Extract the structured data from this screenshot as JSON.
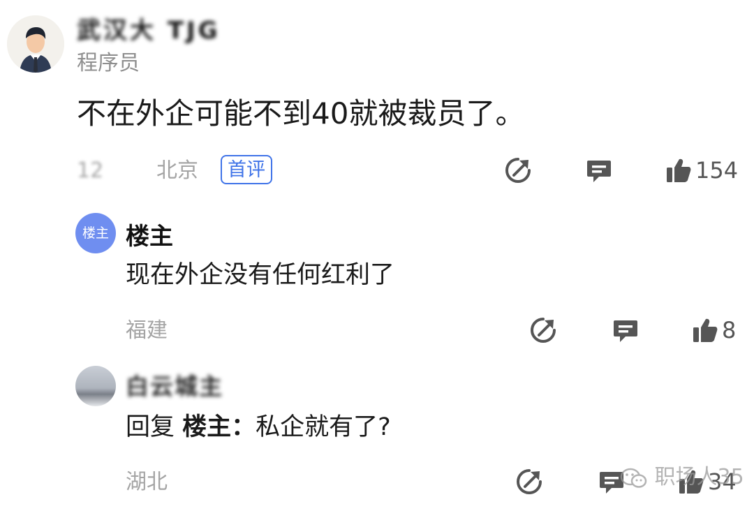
{
  "main_comment": {
    "author_name": "武汉大 TJG",
    "author_title": "程序员",
    "text": "不在外企可能不到40就被裁员了。",
    "date": "12",
    "location": "北京",
    "badge": "首评",
    "likes": "154"
  },
  "replies": [
    {
      "avatar_text": "楼主",
      "name": "楼主",
      "text": "现在外企没有任何红利了",
      "location": "福建",
      "likes": "8"
    },
    {
      "name": "白云城主",
      "reply_prefix": "回复",
      "reply_to": "楼主：",
      "text": "私企就有了?",
      "location": "湖北",
      "likes": "34"
    }
  ],
  "watermark": "职场人35",
  "icons": {
    "share": "share-icon",
    "reply": "comment-icon",
    "like": "thumbs-up-icon"
  },
  "colors": {
    "accent": "#3f73e8",
    "icon": "#555555",
    "meta": "#a4a4a4"
  }
}
